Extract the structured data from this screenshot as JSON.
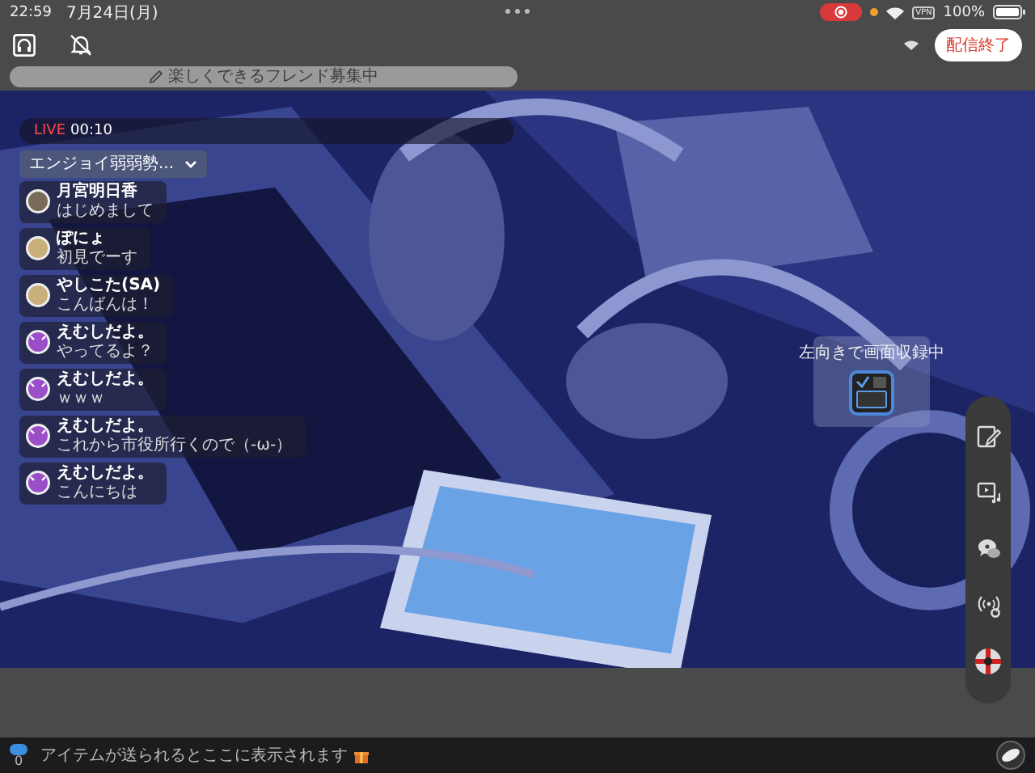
{
  "status_bar": {
    "time": "22:59",
    "date": "7月24日(月)",
    "vpn": "VPN",
    "battery": "100%"
  },
  "toolbar": {
    "end_button": "配信終了"
  },
  "title_field": {
    "value": "楽しくできるフレンド募集中"
  },
  "live": {
    "label": "LIVE",
    "elapsed": "00:10"
  },
  "channel_dropdown": {
    "label": "エンジョイ弱弱勢..."
  },
  "comments": [
    {
      "name": "月宮明日香",
      "text": "はじめまして"
    },
    {
      "kind": "character",
      "name": "ぽにょ",
      "text": "初見でーす"
    },
    {
      "kind": "character",
      "name": "やしこた(SA)",
      "text": "こんばんは！"
    },
    {
      "kind": "devil",
      "name": "えむしだよ。",
      "text": "やってるよ？"
    },
    {
      "kind": "devil",
      "name": "えむしだよ。",
      "text": "ｗｗｗ"
    },
    {
      "kind": "devil",
      "name": "えむしだよ。",
      "text": "これから市役所行くので（-ω-）"
    },
    {
      "kind": "devil",
      "name": "えむしだよ。",
      "text": "こんにちは"
    }
  ],
  "orientation_notice": {
    "text": "左向きで画面収録中"
  },
  "gift_bar": {
    "count": "0",
    "message": "アイテムが送られるとここに表示されます"
  }
}
